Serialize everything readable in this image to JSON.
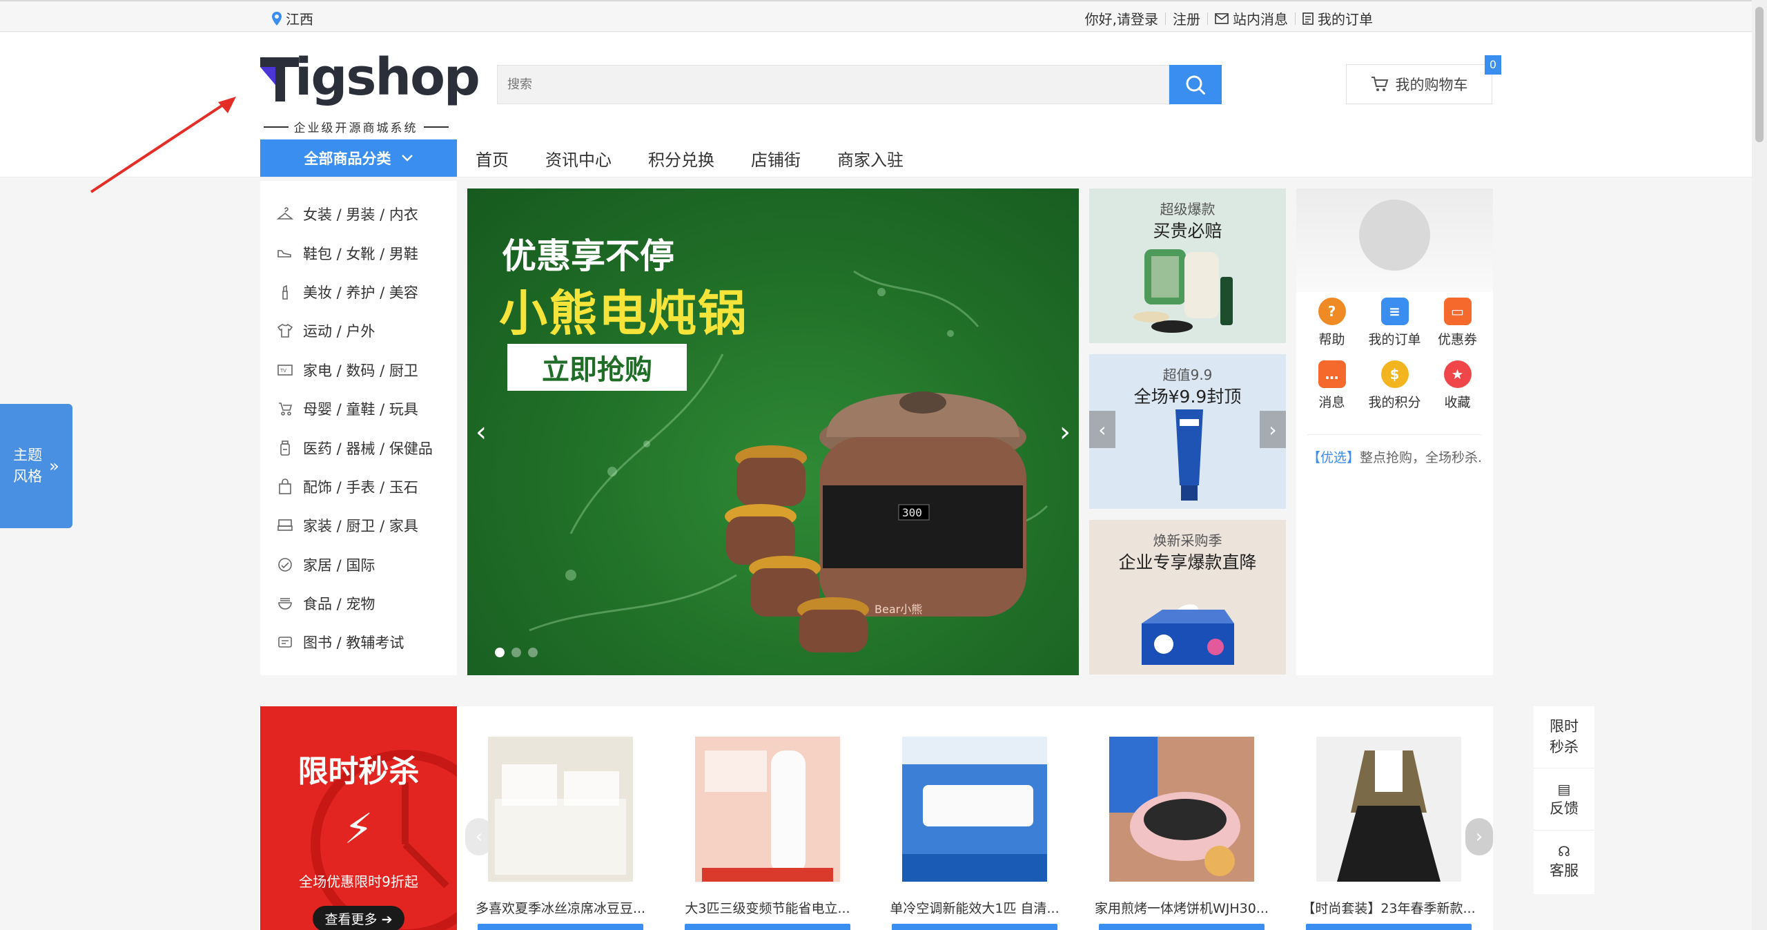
{
  "topbar": {
    "location": "江西",
    "greeting": "你好,请登录",
    "register": "注册",
    "messages": "站内消息",
    "orders": "我的订单"
  },
  "logo": {
    "name": "Tigshop",
    "tagline": "企业级开源商城系统"
  },
  "search": {
    "placeholder": "搜索"
  },
  "cart": {
    "label": "我的购物车",
    "count": "0"
  },
  "nav": {
    "all_categories": "全部商品分类",
    "links": [
      "首页",
      "资讯中心",
      "积分兑换",
      "店铺街",
      "商家入驻"
    ]
  },
  "categories": [
    "女装 / 男装 / 内衣",
    "鞋包 / 女靴 / 男鞋",
    "美妆 / 养护 / 美容",
    "运动 / 户外",
    "家电 / 数码 / 厨卫",
    "母婴 / 童鞋 / 玩具",
    "医药 / 器械 / 保健品",
    "配饰 / 手表 / 玉石",
    "家装 / 厨卫 / 家具",
    "家居 / 国际",
    "食品 / 宠物",
    "图书 / 教辅考试"
  ],
  "banner": {
    "line1": "优惠享不停",
    "line2": "小熊电炖锅",
    "cta": "立即抢购",
    "display": "300",
    "brand": "Bear小熊"
  },
  "promos": [
    {
      "small": "超级爆款",
      "big": "买贵必赔"
    },
    {
      "small": "超值9.9",
      "big": "全场¥9.9封顶"
    },
    {
      "small": "焕新采购季",
      "big": "企业专享爆款直降"
    }
  ],
  "user_panel": {
    "quick_links": [
      {
        "label": "帮助",
        "icon": "question-icon",
        "color": "#f08a24"
      },
      {
        "label": "我的订单",
        "icon": "order-icon",
        "color": "#3a8ef0"
      },
      {
        "label": "优惠券",
        "icon": "coupon-icon",
        "color": "#f56a2c"
      },
      {
        "label": "消息",
        "icon": "message-icon",
        "color": "#f56a2c"
      },
      {
        "label": "我的积分",
        "icon": "coins-icon",
        "color": "#f2b51f"
      },
      {
        "label": "收藏",
        "icon": "star-icon",
        "color": "#f0464a"
      }
    ],
    "notice_tag": "【优选】",
    "notice_text": "整点抢购，全场秒杀..."
  },
  "theme_button": {
    "line1": "主题",
    "line2": "风格"
  },
  "flash_sale": {
    "title": "限时秒杀",
    "desc": "全场优惠限时9折起",
    "more": "查看更多"
  },
  "products": [
    "多喜欢夏季冰丝凉席冰豆豆...",
    "大3匹三级变频节能省电立...",
    "单冷空调新能效大1匹 自清...",
    "家用煎烤一体烤饼机WJH30...",
    "【时尚套装】23年春季新款..."
  ],
  "right_bar": {
    "flash": "限时秒杀",
    "feedback": "反馈",
    "service": "客服"
  },
  "colors": {
    "accent": "#3a8ef0",
    "flash_red": "#e32521"
  }
}
